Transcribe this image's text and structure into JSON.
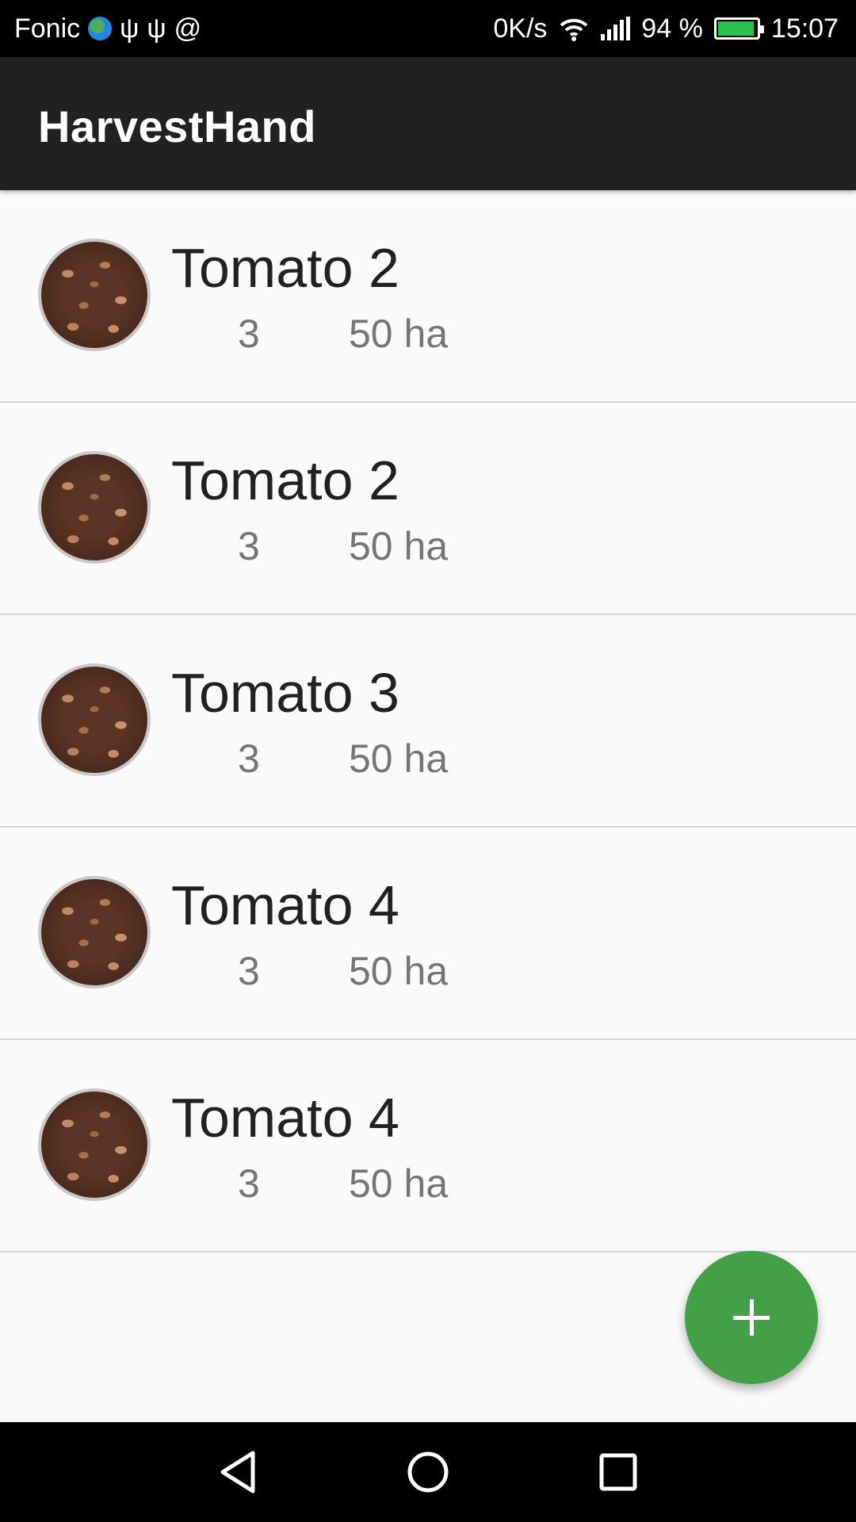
{
  "status_bar": {
    "carrier": "Fonic",
    "icons": [
      "globe-icon",
      "usb-icon",
      "usb-icon",
      "at-icon",
      "wifi-icon",
      "signal-icon",
      "battery-icon"
    ],
    "net_speed": "0K/s",
    "battery_percent": "94 %",
    "battery_level": 0.94,
    "time": "15:07"
  },
  "app_bar": {
    "title": "HarvestHand"
  },
  "crops": [
    {
      "name": "Tomato 2",
      "count": "3",
      "area": "50 ha",
      "icon": "coffee-beans-avatar"
    },
    {
      "name": "Tomato 2",
      "count": "3",
      "area": "50 ha",
      "icon": "coffee-beans-avatar"
    },
    {
      "name": "Tomato 3",
      "count": "3",
      "area": "50 ha",
      "icon": "coffee-beans-avatar"
    },
    {
      "name": "Tomato 4",
      "count": "3",
      "area": "50 ha",
      "icon": "coffee-beans-avatar"
    },
    {
      "name": "Tomato 4",
      "count": "3",
      "area": "50 ha",
      "icon": "coffee-beans-avatar"
    }
  ],
  "fab": {
    "icon": "plus-icon",
    "color": "#43a047"
  },
  "nav_bar": {
    "buttons": [
      "back-icon",
      "home-icon",
      "recents-icon"
    ]
  },
  "colors": {
    "app_bar": "#212121",
    "background": "#fafafa",
    "accent": "#43a047"
  }
}
